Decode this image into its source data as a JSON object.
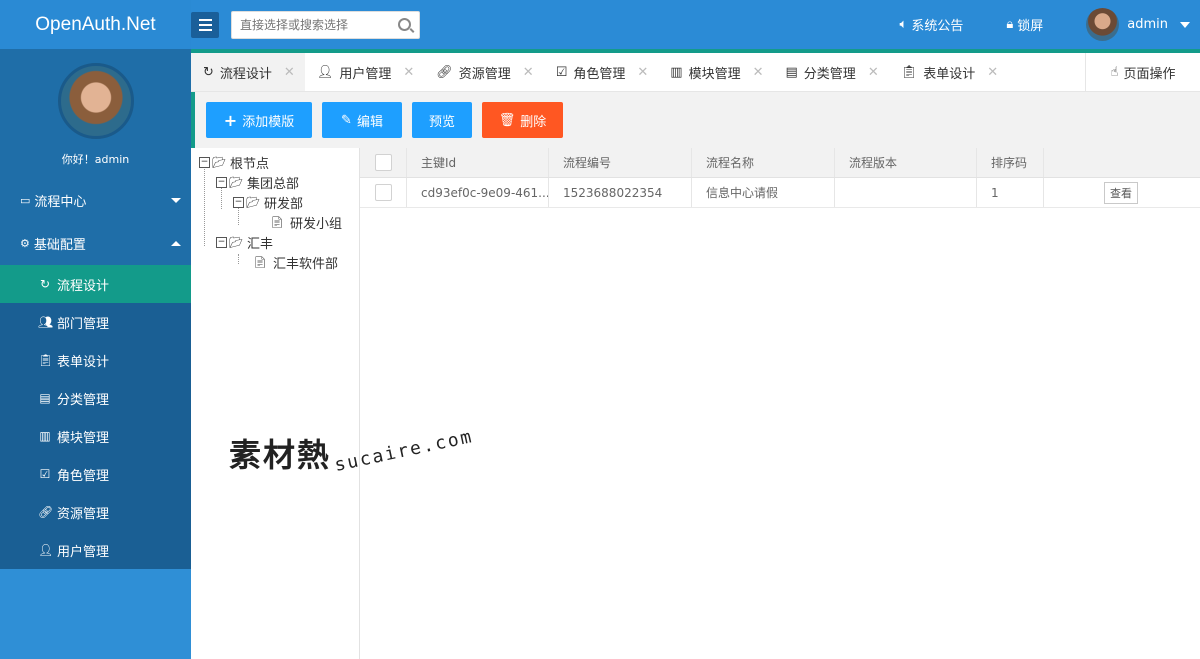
{
  "header": {
    "logo": "OpenAuth.Net",
    "search_placeholder": "直接选择或搜索选择",
    "announcement": "系统公告",
    "lock": "锁屏",
    "username": "admin"
  },
  "sidebar": {
    "greeting": "你好！admin",
    "groups": [
      {
        "label": "流程中心",
        "icon": "window-icon",
        "expanded": false
      },
      {
        "label": "基础配置",
        "icon": "gear-icon",
        "expanded": true
      }
    ],
    "items": [
      {
        "label": "流程设计",
        "icon": "refresh-icon",
        "active": true
      },
      {
        "label": "部门管理",
        "icon": "users-icon"
      },
      {
        "label": "表单设计",
        "icon": "clipboard-icon"
      },
      {
        "label": "分类管理",
        "icon": "calendar-icon"
      },
      {
        "label": "模块管理",
        "icon": "blocks-icon"
      },
      {
        "label": "角色管理",
        "icon": "check-square-icon"
      },
      {
        "label": "资源管理",
        "icon": "link-icon"
      },
      {
        "label": "用户管理",
        "icon": "user-icon"
      }
    ]
  },
  "tabs": [
    {
      "label": "流程设计",
      "active": true
    },
    {
      "label": "用户管理"
    },
    {
      "label": "资源管理"
    },
    {
      "label": "角色管理"
    },
    {
      "label": "模块管理"
    },
    {
      "label": "分类管理"
    },
    {
      "label": "表单设计"
    }
  ],
  "page_op": "页面操作",
  "toolbar": {
    "add": "添加模版",
    "edit": "编辑",
    "preview": "预览",
    "delete": "删除"
  },
  "tree": {
    "root": "根节点",
    "n1": "集团总部",
    "n1a": "研发部",
    "n1a1": "研发小组",
    "n2": "汇丰",
    "n2a": "汇丰软件部"
  },
  "grid": {
    "columns": [
      "主键Id",
      "流程编号",
      "流程名称",
      "流程版本",
      "排序码"
    ],
    "rows": [
      {
        "id": "cd93ef0c-9e09-461...",
        "code": "1523688022354",
        "name": "信息中心请假",
        "version": "",
        "sort": "1",
        "action": "查看"
      }
    ]
  },
  "watermark": {
    "cn": "素材熱",
    "en": "sucaire.com"
  },
  "colors": {
    "header": "#2b8bd6",
    "accent": "#139b8a",
    "primary_button": "#1e9fff",
    "danger_button": "#ff5722"
  }
}
